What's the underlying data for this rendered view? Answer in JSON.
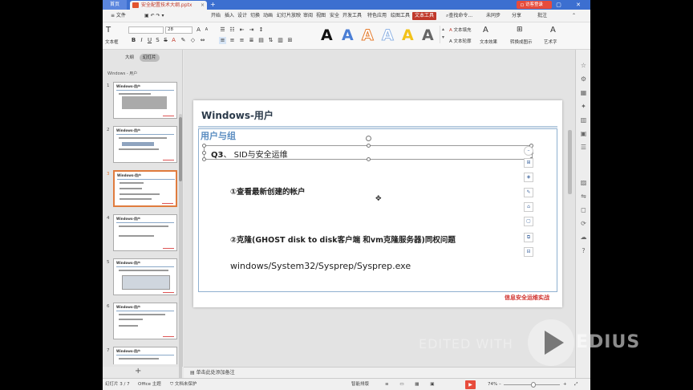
{
  "titlebar": {
    "home_tab": "首页",
    "doc_tab": "安全配置技术大纲.pptx",
    "login": "访客登录"
  },
  "menubar": {
    "file": "≡ 文件",
    "items": [
      "开始",
      "插入",
      "设计",
      "切换",
      "动画",
      "幻灯片放映",
      "审阅",
      "视图",
      "安全",
      "开发工具",
      "特色应用",
      "绘图工具"
    ],
    "active_tab": "文本工具",
    "search": "查找命令...",
    "unsynced": "未同步",
    "share": "分享",
    "comment": "批注"
  },
  "ribbon": {
    "font_name": "",
    "font_size": "28",
    "textbox_label": "文本框",
    "text_fill": "文本填充",
    "text_outline": "文本轮廓",
    "text_effect": "文本效果",
    "convert_art": "转换成图示",
    "shape_effect": "形状效果",
    "text_effect2": "艺术字",
    "sample_letter": "A"
  },
  "leftpanel": {
    "tab_outline": "大纲",
    "tab_slides": "幻灯片",
    "outline_text": "Windows - 用户",
    "thumb_title": "Windows-用户",
    "slide_numbers": [
      "1",
      "2",
      "3",
      "4",
      "5",
      "6",
      "7"
    ]
  },
  "slide": {
    "title": "Windows-用户",
    "section": "用户与组",
    "q3_label": "Q3",
    "q3_text": "、 SID与安全运维",
    "line1": "①查看最新创建的帐户",
    "line2": "②克隆(GHOST disk to disk客户端 和vm克隆服务器)同权问题",
    "line3": "windows/System32/Sysprep/Sysprep.exe",
    "footer": "信息安全运维实战"
  },
  "notes": {
    "placeholder": "单击此处添加备注"
  },
  "statusbar": {
    "slide_index": "幻灯片 3 / 7",
    "theme": "Office 主题",
    "protect": "文档未保护",
    "smart": "智能排版",
    "zoom": "74%"
  },
  "watermark": {
    "edited": "EDITED WITH",
    "brand": "EDIUS"
  },
  "colors": {
    "accent_red": "#d0312d",
    "title_bar_blue": "#3c6fd0",
    "section_blue": "#5a8cc0"
  }
}
